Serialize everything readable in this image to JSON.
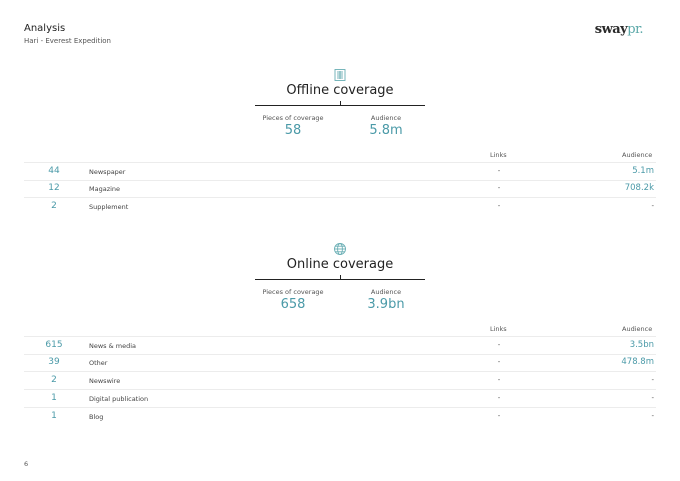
{
  "header": {
    "title": "Analysis",
    "subtitle": "Hari - Everest Expedition"
  },
  "logo": {
    "part1": "sway",
    "part2": "pr."
  },
  "offline": {
    "icon": "newspaper-icon",
    "title": "Offline coverage",
    "pieces_label": "Pieces of coverage",
    "pieces_value": "58",
    "audience_label": "Audience",
    "audience_value": "5.8m",
    "col_links": "Links",
    "col_audience": "Audience",
    "rows": [
      {
        "count": "44",
        "name": "Newspaper",
        "links": "-",
        "audience": "5.1m"
      },
      {
        "count": "12",
        "name": "Magazine",
        "links": "-",
        "audience": "708.2k"
      },
      {
        "count": "2",
        "name": "Supplement",
        "links": "-",
        "audience": "-"
      }
    ]
  },
  "online": {
    "icon": "globe-icon",
    "title": "Online coverage",
    "pieces_label": "Pieces of coverage",
    "pieces_value": "658",
    "audience_label": "Audience",
    "audience_value": "3.9bn",
    "col_links": "Links",
    "col_audience": "Audience",
    "rows": [
      {
        "count": "615",
        "name": "News & media",
        "links": "-",
        "audience": "3.5bn"
      },
      {
        "count": "39",
        "name": "Other",
        "links": "-",
        "audience": "478.8m"
      },
      {
        "count": "2",
        "name": "Newswire",
        "links": "-",
        "audience": "-"
      },
      {
        "count": "1",
        "name": "Digital publication",
        "links": "-",
        "audience": "-"
      },
      {
        "count": "1",
        "name": "Blog",
        "links": "-",
        "audience": "-"
      }
    ]
  },
  "page_number": "6"
}
